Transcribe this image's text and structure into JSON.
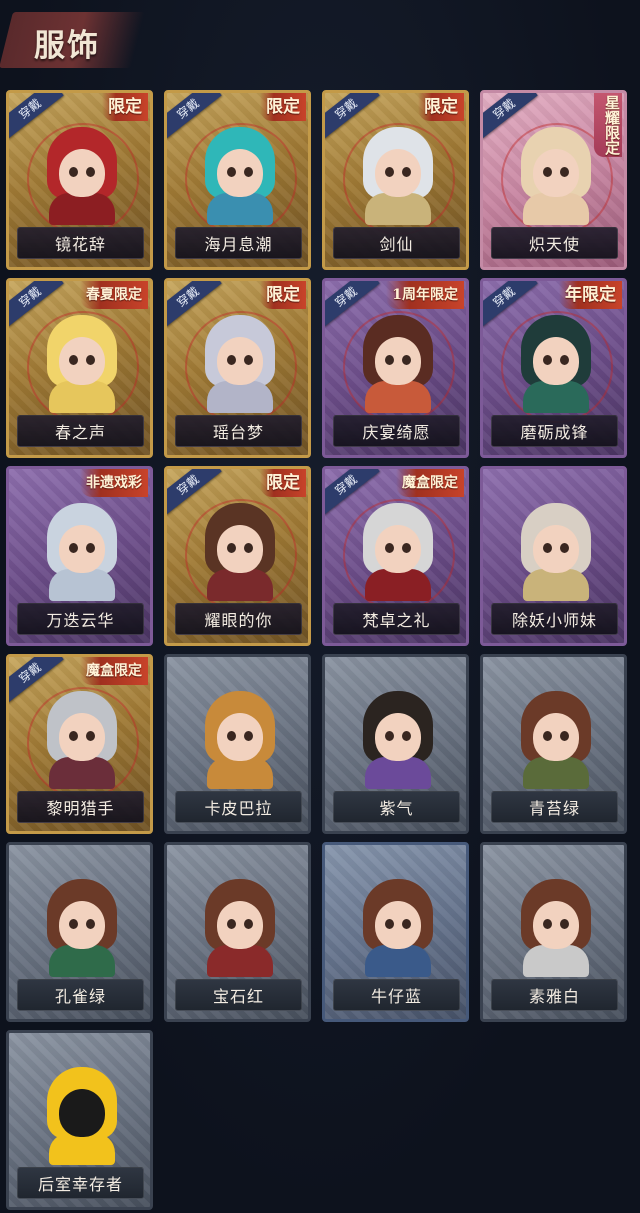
{
  "header": {
    "title": "服饰"
  },
  "wear_label": "穿戴",
  "costumes": [
    {
      "name": "镜花辞",
      "badge": "限定",
      "worn": true,
      "frame": "gold",
      "hair": "#b3272a",
      "body": "#8c1e22"
    },
    {
      "name": "海月息潮",
      "badge": "限定",
      "worn": true,
      "frame": "gold",
      "hair": "#2fb7b8",
      "body": "#3a8fb0"
    },
    {
      "name": "剑仙",
      "badge": "限定",
      "worn": true,
      "frame": "gold",
      "hair": "#dfe3e8",
      "body": "#c9b37a"
    },
    {
      "name": "炽天使",
      "badge": "星耀限定",
      "worn": true,
      "frame": "pink",
      "hair": "#e8d2b0",
      "body": "#e7c9a8",
      "badge_style": "vertical"
    },
    {
      "name": "春之声",
      "badge": "春夏限定",
      "worn": true,
      "frame": "gold",
      "hair": "#f1d46a",
      "body": "#e6c65c"
    },
    {
      "name": "瑶台梦",
      "badge": "限定",
      "worn": true,
      "frame": "gold",
      "hair": "#c7c9d9",
      "body": "#b2b4c8"
    },
    {
      "name": "庆宴绮愿",
      "badge": "1周年限定",
      "worn": true,
      "frame": "purple",
      "hair": "#5a2c22",
      "body": "#c85a3a"
    },
    {
      "name": "磨砺成锋",
      "badge": "年限定",
      "worn": true,
      "frame": "purple",
      "hair": "#1f3c3a",
      "body": "#2a6a5a"
    },
    {
      "name": "万迭云华",
      "badge": "非遗戏彩",
      "worn": false,
      "frame": "purple",
      "hair": "#c9d3df",
      "body": "#b7c3d3"
    },
    {
      "name": "耀眼的你",
      "badge": "限定",
      "worn": true,
      "frame": "gold",
      "hair": "#5a3424",
      "body": "#7a2a2c"
    },
    {
      "name": "梵卓之礼",
      "badge": "魔盒限定",
      "worn": true,
      "frame": "purple",
      "hair": "#d6d6d6",
      "body": "#8a1f24"
    },
    {
      "name": "除妖小师妹",
      "badge": "",
      "worn": false,
      "frame": "purple",
      "hair": "#d8cfc4",
      "body": "#c9b37a"
    },
    {
      "name": "黎明猎手",
      "badge": "魔盒限定",
      "worn": true,
      "frame": "gold",
      "hair": "#bfc2c8",
      "body": "#6b2e3a"
    },
    {
      "name": "卡皮巴拉",
      "badge": "",
      "worn": false,
      "frame": "grey",
      "hair": "#c88a3a",
      "body": "#c88a3a"
    },
    {
      "name": "紫气",
      "badge": "",
      "worn": false,
      "frame": "grey",
      "hair": "#2b2420",
      "body": "#6b4a9a"
    },
    {
      "name": "青苔绿",
      "badge": "",
      "worn": false,
      "frame": "grey",
      "hair": "#6b3a28",
      "body": "#5a6b3a"
    },
    {
      "name": "孔雀绿",
      "badge": "",
      "worn": false,
      "frame": "grey",
      "hair": "#6b3a28",
      "body": "#2f6b4a"
    },
    {
      "name": "宝石红",
      "badge": "",
      "worn": false,
      "frame": "grey",
      "hair": "#6b3a28",
      "body": "#8a2a2a"
    },
    {
      "name": "牛仔蓝",
      "badge": "",
      "worn": false,
      "frame": "blue",
      "hair": "#6b3a28",
      "body": "#3a5a8a"
    },
    {
      "name": "素雅白",
      "badge": "",
      "worn": false,
      "frame": "grey",
      "hair": "#6b3a28",
      "body": "#c9c9c9"
    },
    {
      "name": "后室幸存者",
      "badge": "",
      "worn": false,
      "frame": "grey",
      "hair": "#f2c21c",
      "body": "#f2c21c",
      "mask": true
    }
  ]
}
